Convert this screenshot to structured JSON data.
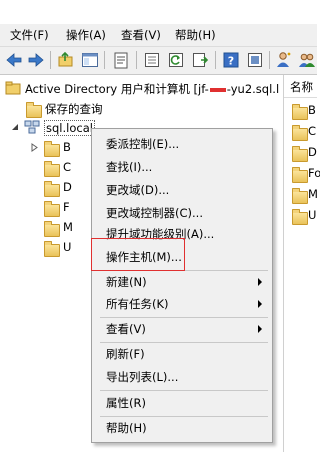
{
  "menubar": {
    "file": "文件(F)",
    "action": "操作(A)",
    "view": "查看(V)",
    "help": "帮助(H)"
  },
  "toolbar": {
    "icons": [
      "back-arrow-icon",
      "forward-arrow-icon",
      "up-folder-icon",
      "console-tree-icon",
      "clipboard-icon",
      "properties-icon",
      "refresh-icon",
      "export-list-icon",
      "help-icon",
      "help-topics-icon",
      "add-user-icon",
      "add-group-icon"
    ]
  },
  "tree": {
    "root_label": "Active Directory 用户和计算机 [jf-",
    "root_label_suffix": "-yu2.sql.l",
    "saved_queries": "保存的查询",
    "domain": "sql.local",
    "children_initials": [
      "B",
      "C",
      "D",
      "F",
      "M",
      "U"
    ]
  },
  "right_pane": {
    "header": "名称",
    "items": [
      "B",
      "C",
      "D",
      "Fo",
      "M",
      "U"
    ]
  },
  "context_menu": {
    "items": [
      {
        "label": "委派控制(E)...",
        "submenu": false
      },
      {
        "label": "查找(I)...",
        "submenu": false
      },
      {
        "label": "更改域(D)...",
        "submenu": false
      },
      {
        "label": "更改域控制器(C)...",
        "submenu": false
      },
      {
        "label": "提升域功能级别(A)...",
        "submenu": false
      },
      {
        "label": "操作主机(M)...",
        "submenu": false
      },
      {
        "label": "新建(N)",
        "submenu": true
      },
      {
        "label": "所有任务(K)",
        "submenu": true
      },
      {
        "label": "查看(V)",
        "submenu": true
      },
      {
        "label": "刷新(F)",
        "submenu": false
      },
      {
        "label": "导出列表(L)...",
        "submenu": false
      },
      {
        "label": "属性(R)",
        "submenu": false
      },
      {
        "label": "帮助(H)",
        "submenu": false
      }
    ]
  },
  "colors": {
    "highlight_border": "#e03030",
    "redaction": "#e03030"
  }
}
